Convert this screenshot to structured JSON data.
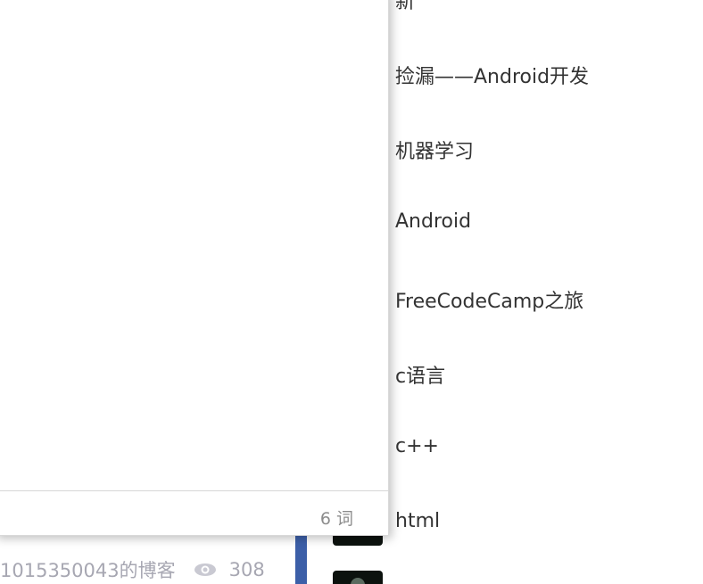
{
  "blog": {
    "author": "1015350043的博客",
    "views": "308"
  },
  "editor": {
    "word_count": "6 词"
  },
  "categories": [
    "新",
    "捡漏——Android开发",
    "机器学习",
    "Android",
    "FreeCodeCamp之旅",
    "c语言",
    "c++",
    "html"
  ]
}
